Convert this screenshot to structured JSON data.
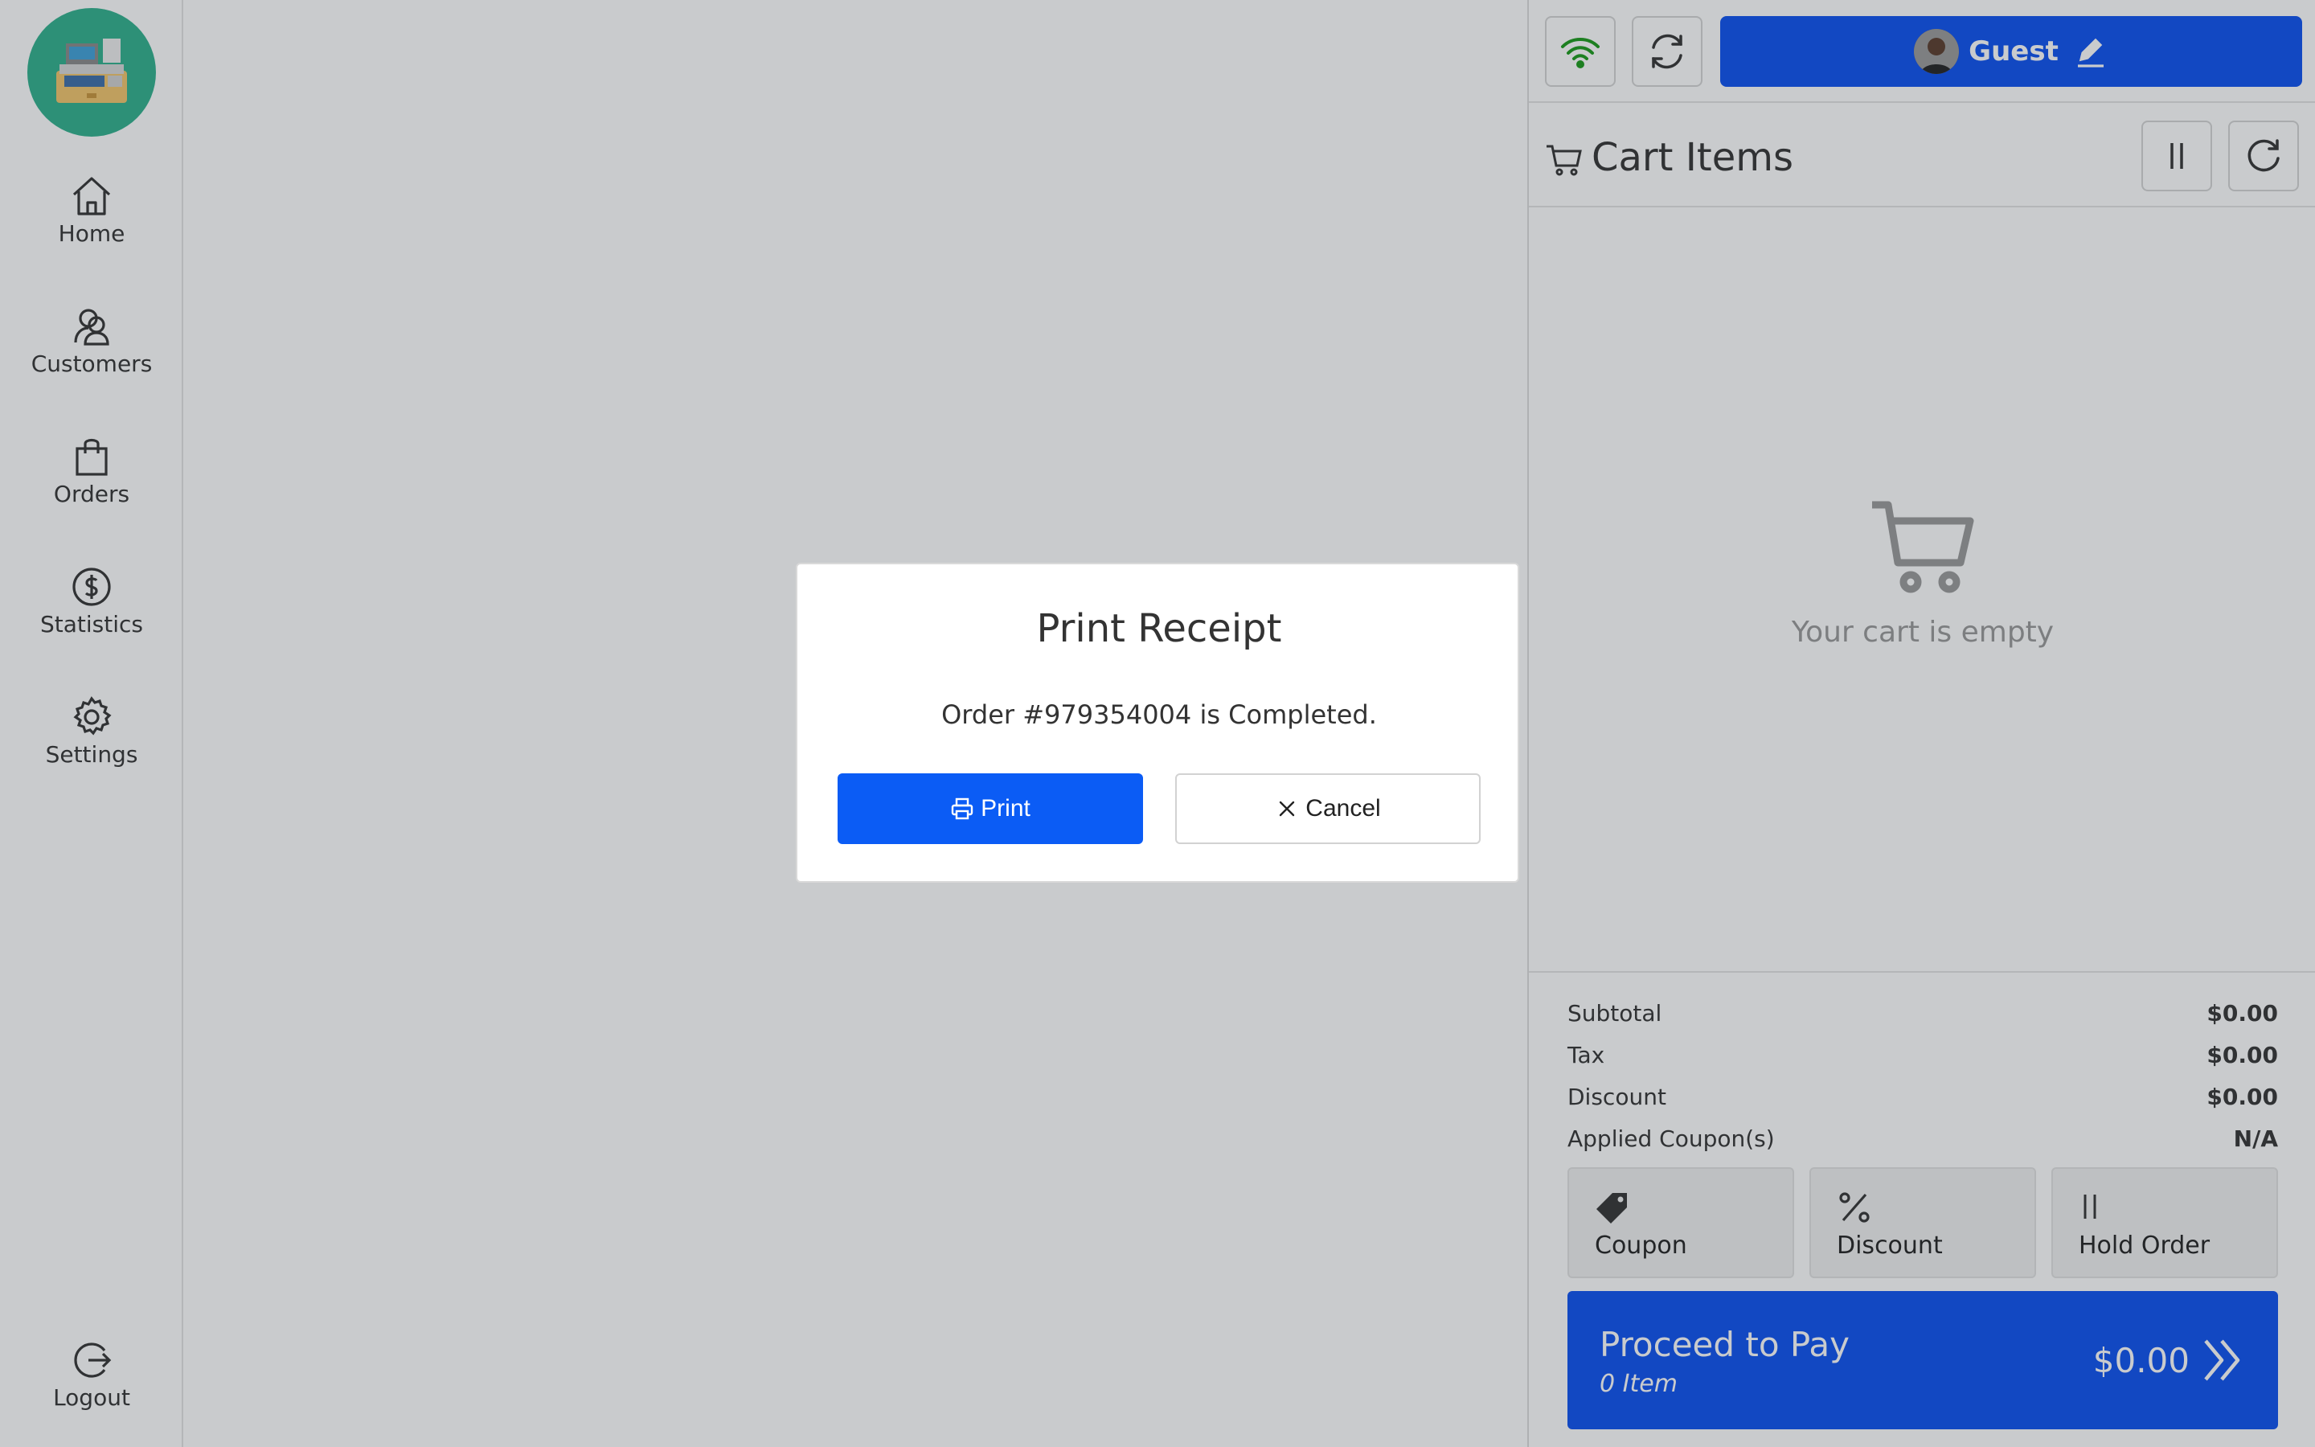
{
  "sidebar": {
    "logo_icon": "cash-register-icon",
    "items": [
      {
        "label": "Home",
        "icon": "home-icon"
      },
      {
        "label": "Customers",
        "icon": "customers-icon"
      },
      {
        "label": "Orders",
        "icon": "shopping-bag-icon"
      },
      {
        "label": "Statistics",
        "icon": "dollar-circle-icon"
      },
      {
        "label": "Settings",
        "icon": "gear-icon"
      }
    ],
    "logout_label": "Logout"
  },
  "topbar": {
    "wifi_icon": "wifi-icon",
    "sync_icon": "sync-icon",
    "customer_name": "Guest"
  },
  "cart": {
    "title": "Cart Items",
    "empty_text": "Your cart is empty",
    "totals": [
      {
        "label": "Subtotal",
        "value": "$0.00"
      },
      {
        "label": "Tax",
        "value": "$0.00"
      },
      {
        "label": "Discount",
        "value": "$0.00"
      },
      {
        "label": "Applied Coupon(s)",
        "value": "N/A"
      }
    ],
    "actions": [
      {
        "label": "Coupon",
        "icon": "tag-icon"
      },
      {
        "label": "Discount",
        "icon": "percent-icon"
      },
      {
        "label": "Hold Order",
        "icon": "pause-icon"
      }
    ],
    "proceed": {
      "label": "Proceed to Pay",
      "items": "0 Item",
      "amount": "$0.00"
    }
  },
  "modal": {
    "title": "Print Receipt",
    "message": "Order #979354004 is Completed.",
    "print_label": "Print",
    "cancel_label": "Cancel"
  },
  "colors": {
    "primary": "#0b50f0",
    "print_button": "#0b5cf5",
    "logo_bg": "#2fb08d",
    "wifi_green": "#1a9a1a"
  }
}
